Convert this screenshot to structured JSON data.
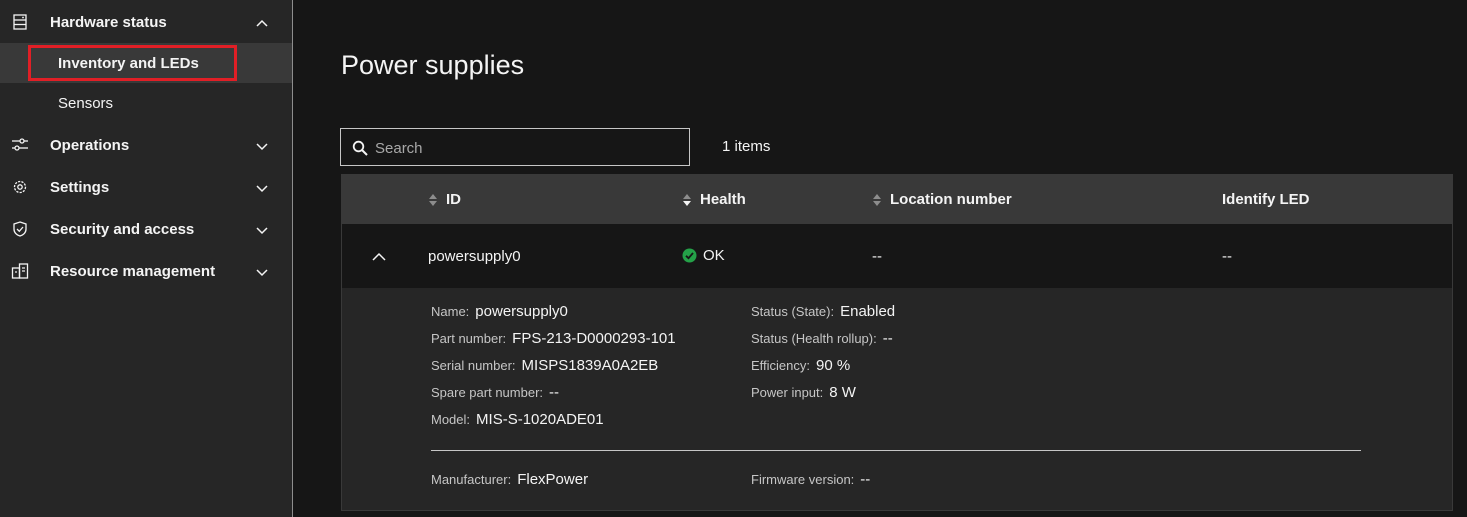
{
  "sidebar": {
    "hardware_status": {
      "label": "Hardware status",
      "icon": "server-icon"
    },
    "sub_items": [
      {
        "label": "Inventory and LEDs"
      },
      {
        "label": "Sensors"
      }
    ],
    "sections": [
      {
        "label": "Operations",
        "icon": "sliders-icon"
      },
      {
        "label": "Settings",
        "icon": "gear-icon"
      },
      {
        "label": "Security and access",
        "icon": "shield-icon"
      },
      {
        "label": "Resource management",
        "icon": "resource-icon"
      }
    ]
  },
  "main": {
    "title": "Power supplies",
    "search": {
      "placeholder": "Search"
    },
    "items_count": "1 items",
    "table": {
      "headers": {
        "id": "ID",
        "health": "Health",
        "location": "Location number",
        "identify": "Identify LED"
      },
      "row": {
        "id": "powersupply0",
        "health": "OK",
        "location": "--",
        "identify": "--"
      },
      "details": {
        "name": {
          "label": "Name:",
          "value": "powersupply0"
        },
        "part_number": {
          "label": "Part number:",
          "value": "FPS-213-D0000293-101"
        },
        "serial_number": {
          "label": "Serial number:",
          "value": "MISPS1839A0A2EB"
        },
        "spare_part_number": {
          "label": "Spare part number:",
          "value": "--"
        },
        "model": {
          "label": "Model:",
          "value": "MIS-S-1020ADE01"
        },
        "status_state": {
          "label": "Status (State):",
          "value": "Enabled"
        },
        "status_health": {
          "label": "Status (Health rollup):",
          "value": "--"
        },
        "efficiency": {
          "label": "Efficiency:",
          "value": "90 %"
        },
        "power_input": {
          "label": "Power input:",
          "value": "8 W"
        },
        "manufacturer": {
          "label": "Manufacturer:",
          "value": "FlexPower"
        },
        "firmware_version": {
          "label": "Firmware version:",
          "value": "--"
        }
      }
    }
  },
  "colors": {
    "background": "#161616",
    "sidebar": "#262626",
    "highlight": "#e11f26",
    "ok": "#24a148"
  }
}
